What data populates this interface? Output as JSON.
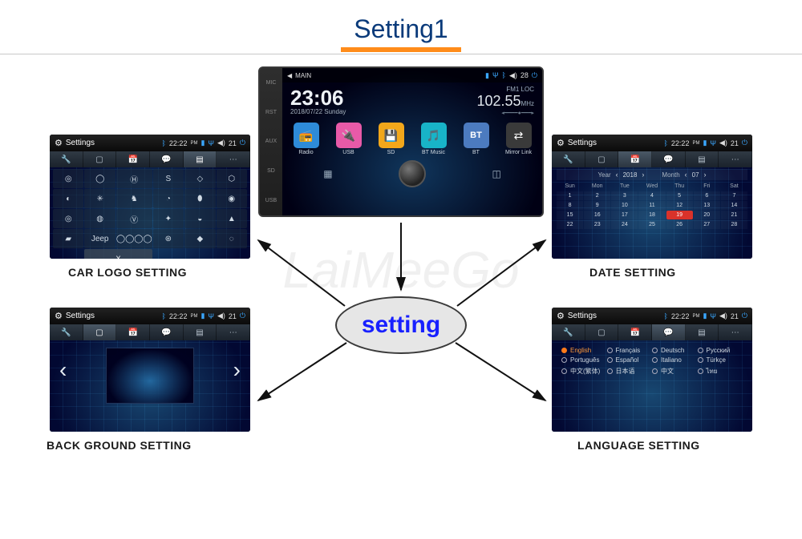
{
  "page": {
    "title": "Setting1",
    "center_label": "setting",
    "watermark": "LaiMeeGo"
  },
  "captions": {
    "car_logo": "CAR LOGO SETTING",
    "background": "BACK GROUND SETTING",
    "date": "DATE  SETTING",
    "language": "LANGUAGE SETTING"
  },
  "header": {
    "label": "Settings",
    "time": "22:22",
    "time_suffix": "PM",
    "vol_icon": "◀",
    "vol": "21"
  },
  "device": {
    "top_label": "MAIN",
    "vol": "28",
    "clock": "23:06",
    "date": "2018/07/22  Sunday",
    "fm_label": "FM1  LOC",
    "freq": "102.55",
    "freq_unit": "MHz",
    "apps": [
      {
        "label": "Radio",
        "color": "#2e8bd9",
        "glyph": "📻"
      },
      {
        "label": "USB",
        "color": "#e85aa8",
        "glyph": "🔌"
      },
      {
        "label": "SD",
        "color": "#f2a71b",
        "glyph": "💾"
      },
      {
        "label": "BT Music",
        "color": "#18b4c8",
        "glyph": "🎵"
      },
      {
        "label": "BT",
        "color": "#4c7bbf",
        "glyph": "BT"
      },
      {
        "label": "Mirror Link",
        "color": "#3a3a3a",
        "glyph": "⇄"
      }
    ],
    "side_labels": [
      "MIC",
      "RST",
      "AUX",
      "SD",
      "USB"
    ]
  },
  "logos": {
    "x_label": "X",
    "cells": [
      "◎",
      "◯",
      "Ⓗ",
      "S",
      "◇",
      "⬡",
      "◐",
      "✳",
      "♞",
      "◔",
      "⬮",
      "◉",
      "◎",
      "◍",
      "Ⓥ",
      "✦",
      "◒",
      "▲",
      "▰",
      "Jeep",
      "◯◯◯◯",
      "⊛",
      "◆",
      "◌"
    ]
  },
  "date_panel": {
    "year_label": "Year",
    "year": "2018",
    "month_label": "Month",
    "month": "07",
    "days_header": [
      "Sun",
      "Mon",
      "Tue",
      "Wed",
      "Thu",
      "Fri",
      "Sat"
    ],
    "weeks": [
      [
        "1",
        "2",
        "3",
        "4",
        "5",
        "6",
        "7"
      ],
      [
        "8",
        "9",
        "10",
        "11",
        "12",
        "13",
        "14"
      ],
      [
        "15",
        "16",
        "17",
        "18",
        "19",
        "20",
        "21"
      ],
      [
        "22",
        "23",
        "24",
        "25",
        "26",
        "27",
        "28"
      ]
    ],
    "today": "19"
  },
  "languages": {
    "items": [
      "English",
      "Français",
      "Deutsch",
      "Русский",
      "Português",
      "Español",
      "Italiano",
      "Türkçe",
      "中文(繁体)",
      "日本语",
      "中文",
      "ไทย"
    ],
    "selected": "English"
  }
}
